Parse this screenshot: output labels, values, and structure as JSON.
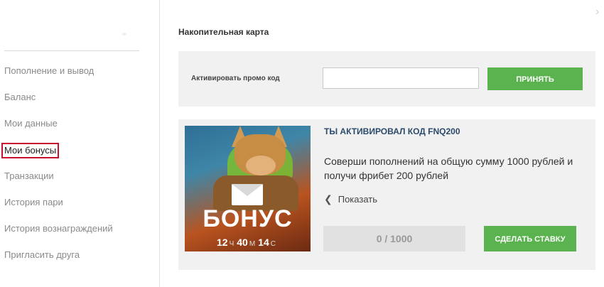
{
  "sidebar": {
    "items": [
      {
        "label": "Пополнение и вывод",
        "active": false
      },
      {
        "label": "Баланс",
        "active": false
      },
      {
        "label": "Мои данные",
        "active": false
      },
      {
        "label": "Мои бонусы",
        "active": true
      },
      {
        "label": "Транзакции",
        "active": false
      },
      {
        "label": "История пари",
        "active": false
      },
      {
        "label": "История вознаграждений",
        "active": false
      },
      {
        "label": "Пригласить друга",
        "active": false
      }
    ]
  },
  "main": {
    "section_title": "Накопительная карта",
    "promo": {
      "label": "Активировать промо код",
      "input_value": "",
      "input_placeholder": "",
      "submit_label": "ПРИНЯТЬ"
    },
    "bonus": {
      "image_text": "БОНУС",
      "timer": {
        "hours": "12",
        "hours_unit": "Ч",
        "minutes": "40",
        "minutes_unit": "М",
        "seconds": "14",
        "seconds_unit": "С"
      },
      "title": "ТЫ АКТИВИРОВАЛ КОД FNQ200",
      "description": "Соверши пополнений на общую сумму 1000 рублей и получи фрибет 200 рублей",
      "show_label": "Показать",
      "progress_text": "0 / 1000",
      "bet_label": "СДЕЛАТЬ СТАВКУ"
    }
  },
  "colors": {
    "accent_green": "#5ab34e",
    "active_border": "#c8102e",
    "title_blue": "#2b4a6b"
  },
  "icons": {
    "top_right": "chevron-right-icon",
    "show": "chevron-left-icon",
    "envelope": "envelope-icon"
  }
}
